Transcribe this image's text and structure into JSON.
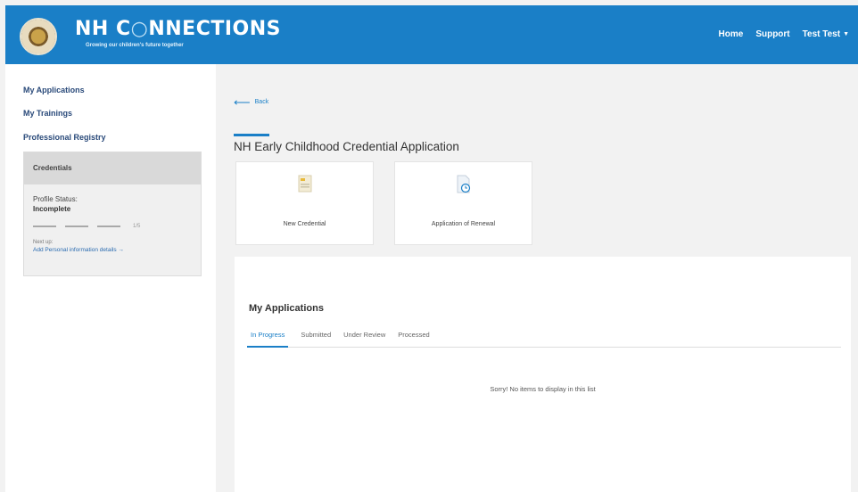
{
  "header": {
    "brand_title_a": "NH C",
    "brand_title_o": "○",
    "brand_title_b": "NNECTIONS",
    "brand_subtitle": "Growing our children's future together",
    "nav": {
      "home": "Home",
      "support": "Support",
      "user": "Test Test"
    },
    "colors": {
      "bar": "#1a7fc7"
    }
  },
  "sidebar": {
    "links": [
      "My Applications",
      "My Trainings",
      "Professional Registry"
    ],
    "credentials": {
      "heading": "Credentials",
      "status_label": "Profile Status:",
      "status_value": "Incomplete",
      "progress_text": "1/5",
      "progress_fraction": 0.2,
      "next_label": "Next up:",
      "next_link": "Add Personal information details →"
    }
  },
  "main": {
    "back_label": "Back",
    "title": "NH Early Childhood Credential Application",
    "tiles": [
      {
        "label": "New Credential",
        "icon": "document-icon"
      },
      {
        "label": "Application of Renewal",
        "icon": "document-clock-icon"
      }
    ],
    "applications": {
      "title": "My Applications",
      "tabs": [
        "In Progress",
        "Submitted",
        "Under Review",
        "Processed"
      ],
      "active_tab": "In Progress",
      "empty_message": "Sorry! No items to display in this list"
    }
  }
}
